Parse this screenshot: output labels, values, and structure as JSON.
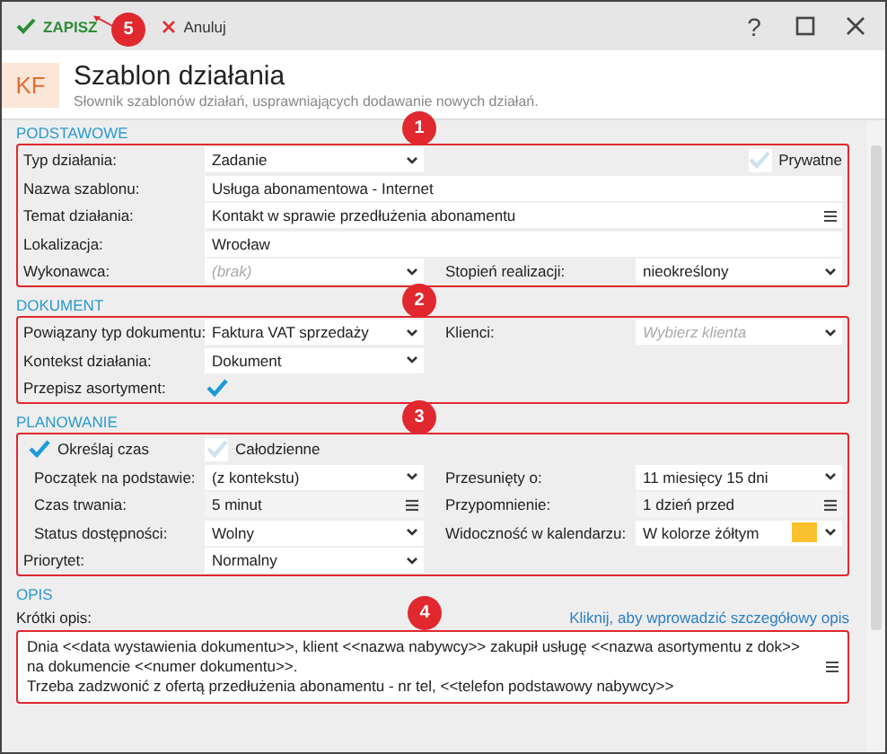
{
  "toolbar": {
    "save": "ZAPISZ",
    "cancel": "Anuluj",
    "help": "?",
    "badge": "5"
  },
  "header": {
    "logo": "KF",
    "title": "Szablon działania",
    "subtitle": "Słownik szablonów działań, usprawniających dodawanie nowych działań."
  },
  "sections": [
    {
      "kind": "form",
      "title": "PODSTAWOWE",
      "badge": "1",
      "rows": [
        {
          "kind": "fields",
          "cells": [
            {
              "kind": "select",
              "label": "Typ działania:",
              "value": "Zadanie"
            },
            {
              "kind": "check",
              "caption": "Prywatne",
              "checked": false
            }
          ]
        },
        {
          "kind": "fields",
          "cells": [
            {
              "kind": "text",
              "label": "Nazwa szablonu:",
              "value": "Usługa abonamentowa - Internet",
              "wide": true
            }
          ]
        },
        {
          "kind": "fields",
          "cells": [
            {
              "kind": "memo",
              "label": "Temat działania:",
              "value": "Kontakt w sprawie przedłużenia abonamentu",
              "wide": true
            }
          ]
        },
        {
          "kind": "fields",
          "cells": [
            {
              "kind": "text",
              "label": "Lokalizacja:",
              "value": "Wrocław",
              "wide": true
            }
          ]
        },
        {
          "kind": "fields",
          "cells": [
            {
              "kind": "select",
              "label": "Wykonawca:",
              "placeholder": "(brak)"
            },
            {
              "kind": "select",
              "label": "Stopień realizacji:",
              "value": "nieokreślony"
            }
          ]
        }
      ]
    },
    {
      "kind": "form",
      "title": "DOKUMENT",
      "badge": "2",
      "rows": [
        {
          "kind": "fields",
          "cells": [
            {
              "kind": "select",
              "label": "Powiązany typ dokumentu:",
              "value": "Faktura VAT sprzedaży"
            },
            {
              "kind": "select",
              "label": "Klienci:",
              "placeholder": "Wybierz klienta"
            }
          ]
        },
        {
          "kind": "fields",
          "cells": [
            {
              "kind": "select",
              "label": "Kontekst działania:",
              "value": "Dokument"
            }
          ]
        },
        {
          "kind": "fields",
          "cells": [
            {
              "kind": "check",
              "label": "Przepisz asortyment:",
              "checked": true
            }
          ]
        }
      ]
    },
    {
      "kind": "form",
      "title": "PLANOWANIE",
      "badge": "3",
      "rows": [
        {
          "kind": "checks",
          "cells": [
            {
              "kind": "check",
              "caption": "Określaj czas",
              "checked": true,
              "children": [
                {
                  "kind": "fields",
                  "cells": [
                    {
                      "kind": "select",
                      "label": "Początek na podstawie:",
                      "value": "(z kontekstu)"
                    },
                    {
                      "kind": "select",
                      "label": "Przesunięty o:",
                      "value": "11 miesięcy 15 dni"
                    }
                  ]
                },
                {
                  "kind": "fields",
                  "cells": [
                    {
                      "kind": "picker",
                      "label": "Czas trwania:",
                      "value": "5 minut"
                    },
                    {
                      "kind": "picker",
                      "label": "Przypomnienie:",
                      "value": "1 dzień przed"
                    }
                  ]
                },
                {
                  "kind": "fields",
                  "cells": [
                    {
                      "kind": "select",
                      "label": "Status dostępności:",
                      "value": "Wolny"
                    },
                    {
                      "kind": "color",
                      "label": "Widoczność w kalendarzu:",
                      "value": "W kolorze żółtym",
                      "color": "#fbc02d"
                    }
                  ]
                }
              ]
            },
            {
              "kind": "check",
              "caption": "Całodzienne",
              "checked": false
            }
          ]
        },
        {
          "kind": "fields",
          "cells": [
            {
              "kind": "select",
              "label": "Priorytet:",
              "value": "Normalny"
            }
          ]
        }
      ]
    },
    {
      "kind": "description",
      "title": "OPIS",
      "badge": "4",
      "label": "Krótki opis:",
      "link": "Kliknij, aby wprowadzić szczegółowy opis",
      "text": "Dnia <<data wystawienia dokumentu>>, klient <<nazwa nabywcy>> zakupił usługę <<nazwa asortymentu z dok>> na dokumencie <<numer dokumentu>>.\nTrzeba zadzwonić z ofertą przedłużenia abonamentu - nr tel, <<telefon podstawowy nabywcy>>"
    }
  ]
}
